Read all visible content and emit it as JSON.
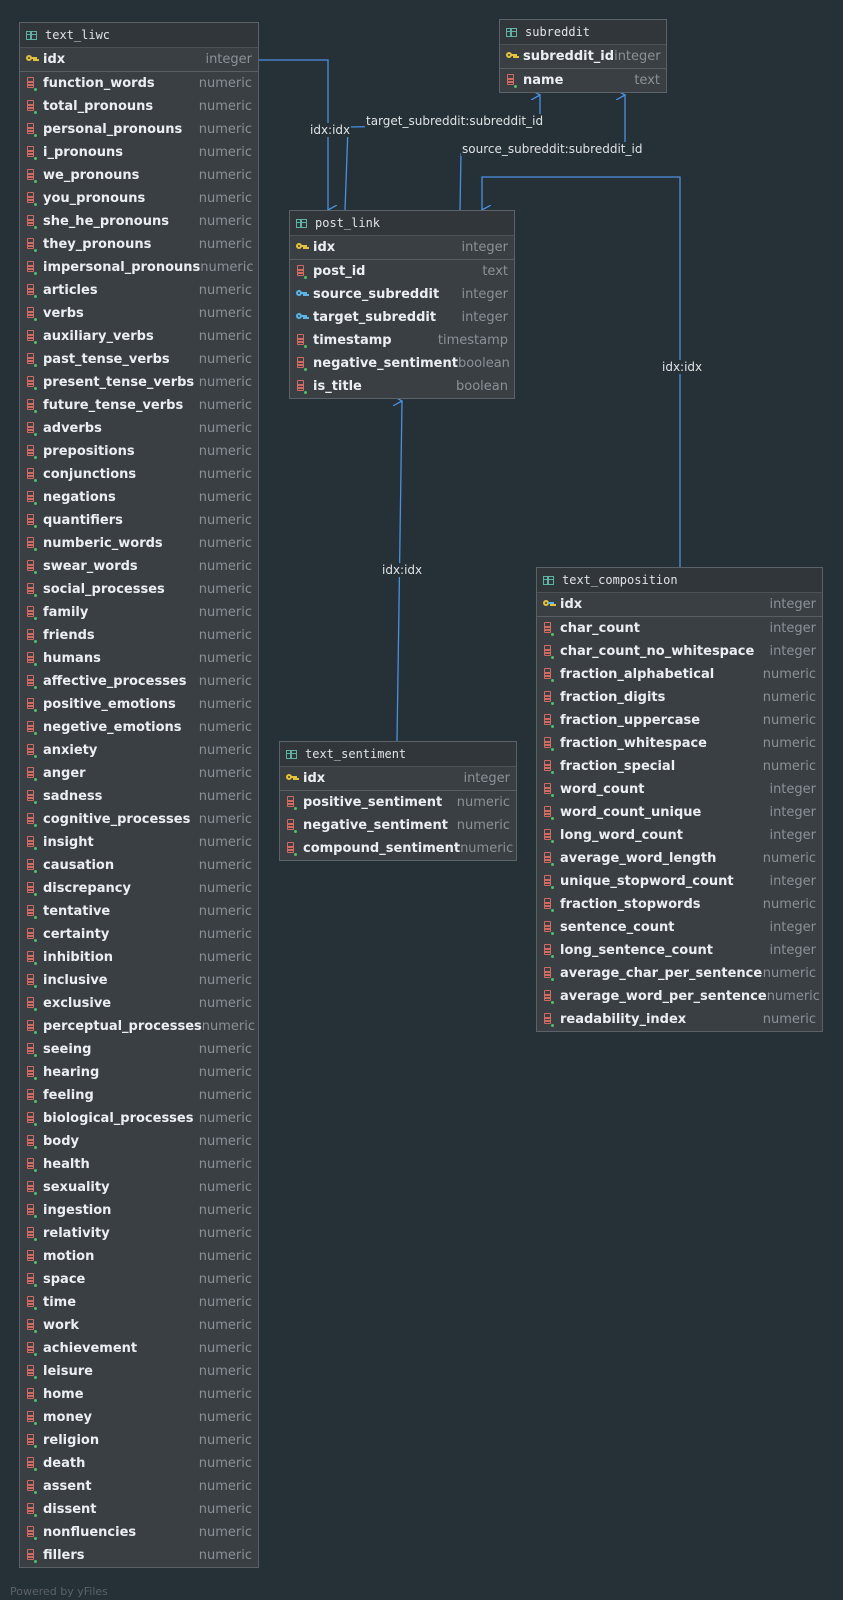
{
  "tables": {
    "text_liwc": {
      "title": "text_liwc",
      "pk": {
        "name": "idx",
        "type": "integer"
      },
      "columns": [
        {
          "name": "function_words",
          "type": "numeric"
        },
        {
          "name": "total_pronouns",
          "type": "numeric"
        },
        {
          "name": "personal_pronouns",
          "type": "numeric"
        },
        {
          "name": "i_pronouns",
          "type": "numeric"
        },
        {
          "name": "we_pronouns",
          "type": "numeric"
        },
        {
          "name": "you_pronouns",
          "type": "numeric"
        },
        {
          "name": "she_he_pronouns",
          "type": "numeric"
        },
        {
          "name": "they_pronouns",
          "type": "numeric"
        },
        {
          "name": "impersonal_pronouns",
          "type": "numeric"
        },
        {
          "name": "articles",
          "type": "numeric"
        },
        {
          "name": "verbs",
          "type": "numeric"
        },
        {
          "name": "auxiliary_verbs",
          "type": "numeric"
        },
        {
          "name": "past_tense_verbs",
          "type": "numeric"
        },
        {
          "name": "present_tense_verbs",
          "type": "numeric"
        },
        {
          "name": "future_tense_verbs",
          "type": "numeric"
        },
        {
          "name": "adverbs",
          "type": "numeric"
        },
        {
          "name": "prepositions",
          "type": "numeric"
        },
        {
          "name": "conjunctions",
          "type": "numeric"
        },
        {
          "name": "negations",
          "type": "numeric"
        },
        {
          "name": "quantifiers",
          "type": "numeric"
        },
        {
          "name": "numberic_words",
          "type": "numeric"
        },
        {
          "name": "swear_words",
          "type": "numeric"
        },
        {
          "name": "social_processes",
          "type": "numeric"
        },
        {
          "name": "family",
          "type": "numeric"
        },
        {
          "name": "friends",
          "type": "numeric"
        },
        {
          "name": "humans",
          "type": "numeric"
        },
        {
          "name": "affective_processes",
          "type": "numeric"
        },
        {
          "name": "positive_emotions",
          "type": "numeric"
        },
        {
          "name": "negetive_emotions",
          "type": "numeric"
        },
        {
          "name": "anxiety",
          "type": "numeric"
        },
        {
          "name": "anger",
          "type": "numeric"
        },
        {
          "name": "sadness",
          "type": "numeric"
        },
        {
          "name": "cognitive_processes",
          "type": "numeric"
        },
        {
          "name": "insight",
          "type": "numeric"
        },
        {
          "name": "causation",
          "type": "numeric"
        },
        {
          "name": "discrepancy",
          "type": "numeric"
        },
        {
          "name": "tentative",
          "type": "numeric"
        },
        {
          "name": "certainty",
          "type": "numeric"
        },
        {
          "name": "inhibition",
          "type": "numeric"
        },
        {
          "name": "inclusive",
          "type": "numeric"
        },
        {
          "name": "exclusive",
          "type": "numeric"
        },
        {
          "name": "perceptual_processes",
          "type": "numeric"
        },
        {
          "name": "seeing",
          "type": "numeric"
        },
        {
          "name": "hearing",
          "type": "numeric"
        },
        {
          "name": "feeling",
          "type": "numeric"
        },
        {
          "name": "biological_processes",
          "type": "numeric"
        },
        {
          "name": "body",
          "type": "numeric"
        },
        {
          "name": "health",
          "type": "numeric"
        },
        {
          "name": "sexuality",
          "type": "numeric"
        },
        {
          "name": "ingestion",
          "type": "numeric"
        },
        {
          "name": "relativity",
          "type": "numeric"
        },
        {
          "name": "motion",
          "type": "numeric"
        },
        {
          "name": "space",
          "type": "numeric"
        },
        {
          "name": "time",
          "type": "numeric"
        },
        {
          "name": "work",
          "type": "numeric"
        },
        {
          "name": "achievement",
          "type": "numeric"
        },
        {
          "name": "leisure",
          "type": "numeric"
        },
        {
          "name": "home",
          "type": "numeric"
        },
        {
          "name": "money",
          "type": "numeric"
        },
        {
          "name": "religion",
          "type": "numeric"
        },
        {
          "name": "death",
          "type": "numeric"
        },
        {
          "name": "assent",
          "type": "numeric"
        },
        {
          "name": "dissent",
          "type": "numeric"
        },
        {
          "name": "nonfluencies",
          "type": "numeric"
        },
        {
          "name": "fillers",
          "type": "numeric"
        }
      ]
    },
    "subreddit": {
      "title": "subreddit",
      "pk": {
        "name": "subreddit_id",
        "type": "integer"
      },
      "columns": [
        {
          "name": "name",
          "type": "text"
        }
      ]
    },
    "post_link": {
      "title": "post_link",
      "pk": {
        "name": "idx",
        "type": "integer"
      },
      "columns": [
        {
          "name": "post_id",
          "type": "text",
          "icon": "col"
        },
        {
          "name": "source_subreddit",
          "type": "integer",
          "icon": "fk"
        },
        {
          "name": "target_subreddit",
          "type": "integer",
          "icon": "fk"
        },
        {
          "name": "timestamp",
          "type": "timestamp",
          "icon": "col"
        },
        {
          "name": "negative_sentiment",
          "type": "boolean",
          "icon": "col"
        },
        {
          "name": "is_title",
          "type": "boolean",
          "icon": "col"
        }
      ]
    },
    "text_sentiment": {
      "title": "text_sentiment",
      "pk": {
        "name": "idx",
        "type": "integer"
      },
      "columns": [
        {
          "name": "positive_sentiment",
          "type": "numeric"
        },
        {
          "name": "negative_sentiment",
          "type": "numeric"
        },
        {
          "name": "compound_sentiment",
          "type": "numeric"
        }
      ]
    },
    "text_composition": {
      "title": "text_composition",
      "pk": {
        "name": "idx",
        "type": "integer"
      },
      "columns": [
        {
          "name": "char_count",
          "type": "integer"
        },
        {
          "name": "char_count_no_whitespace",
          "type": "integer"
        },
        {
          "name": "fraction_alphabetical",
          "type": "numeric"
        },
        {
          "name": "fraction_digits",
          "type": "numeric"
        },
        {
          "name": "fraction_uppercase",
          "type": "numeric"
        },
        {
          "name": "fraction_whitespace",
          "type": "numeric"
        },
        {
          "name": "fraction_special",
          "type": "numeric"
        },
        {
          "name": "word_count",
          "type": "integer"
        },
        {
          "name": "word_count_unique",
          "type": "integer"
        },
        {
          "name": "long_word_count",
          "type": "integer"
        },
        {
          "name": "average_word_length",
          "type": "numeric"
        },
        {
          "name": "unique_stopword_count",
          "type": "integer"
        },
        {
          "name": "fraction_stopwords",
          "type": "numeric"
        },
        {
          "name": "sentence_count",
          "type": "integer"
        },
        {
          "name": "long_sentence_count",
          "type": "integer"
        },
        {
          "name": "average_char_per_sentence",
          "type": "numeric"
        },
        {
          "name": "average_word_per_sentence",
          "type": "numeric"
        },
        {
          "name": "readability_index",
          "type": "numeric"
        }
      ]
    }
  },
  "edge_labels": {
    "liwc_post": "idx:idx",
    "target": "target_subreddit:subreddit_id",
    "source": "source_subreddit:subreddit_id",
    "composition_post": "idx:idx",
    "sentiment_post": "idx:idx"
  },
  "footer": "Powered by yFiles"
}
